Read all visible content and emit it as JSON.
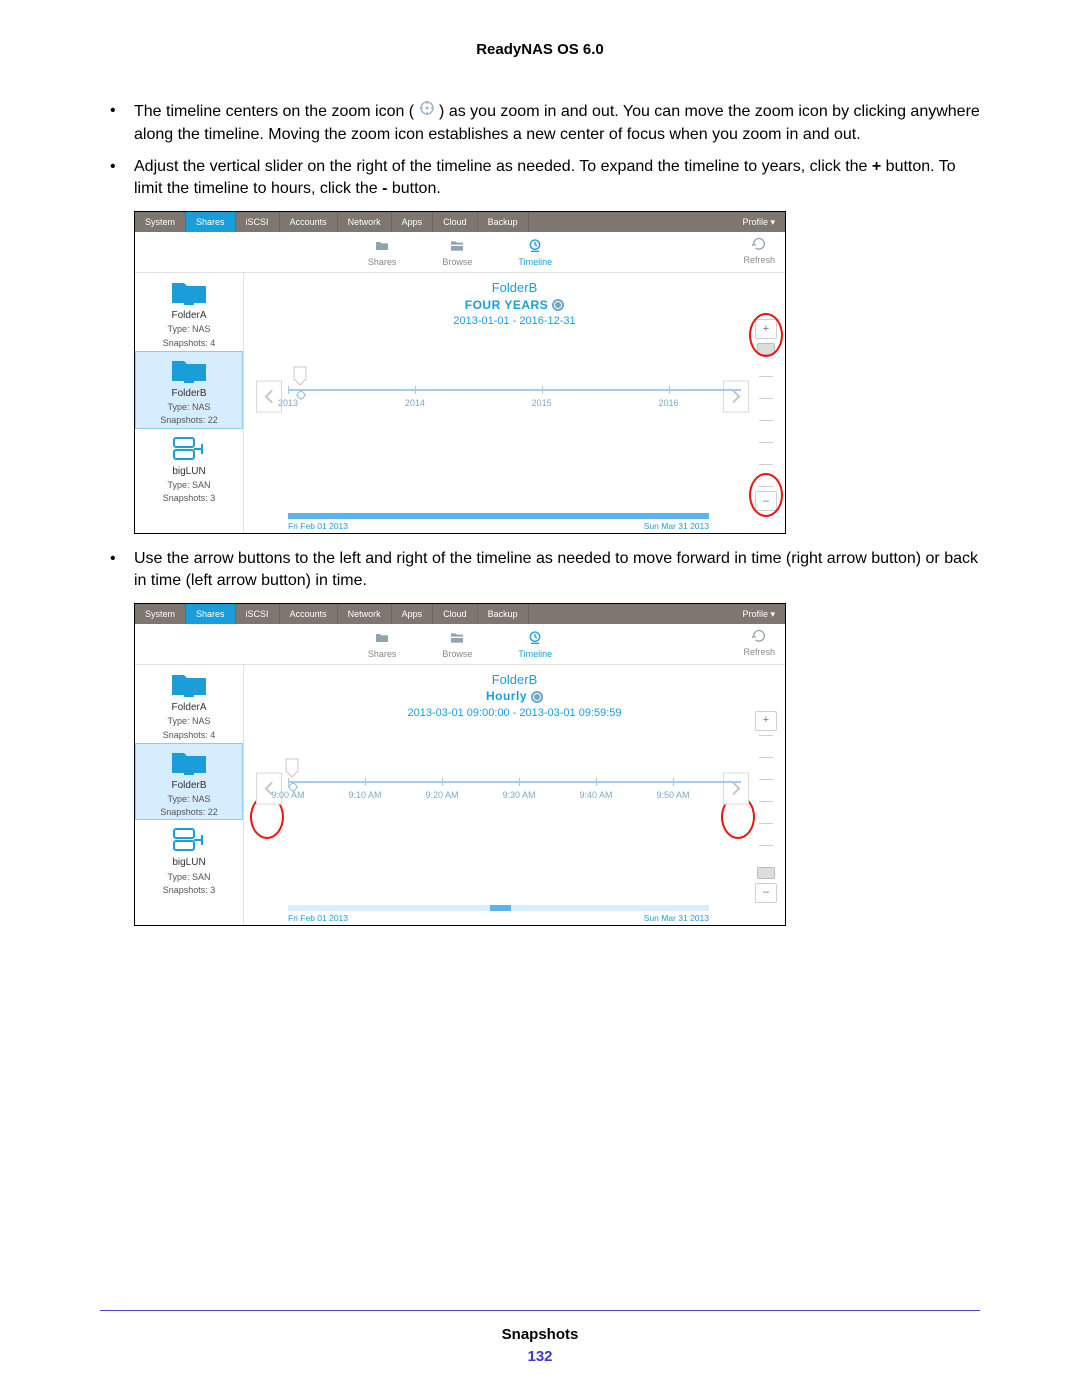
{
  "doc": {
    "title": "ReadyNAS OS 6.0",
    "footer_section": "Snapshots",
    "page_number": "132"
  },
  "bullets": {
    "b1_a": "The timeline centers on the zoom icon (",
    "b1_b": ") as you zoom in and out. You can move the zoom icon by clicking anywhere along the timeline. Moving the zoom icon establishes a new center of focus when you zoom in and out.",
    "b2_a": "Adjust the vertical slider on the right of the timeline as needed. To expand the timeline to years, click the ",
    "b2_plus": "+",
    "b2_b": " button. To limit the timeline to hours, click the ",
    "b2_minus": "-",
    "b2_c": " button.",
    "b3": "Use the arrow buttons to the left and right of the timeline as needed to move forward in time (right arrow button) or back in time (left arrow button) in time."
  },
  "nav": {
    "tabs": [
      "System",
      "Shares",
      "iSCSI",
      "Accounts",
      "Network",
      "Apps",
      "Cloud",
      "Backup"
    ],
    "profile": "Profile ▾"
  },
  "subnav": {
    "shares": "Shares",
    "browse": "Browse",
    "timeline": "Timeline",
    "refresh": "Refresh"
  },
  "sidebar": [
    {
      "name": "FolderA",
      "type": "Type:  NAS",
      "snap": "Snapshots:  4",
      "icon": "folder"
    },
    {
      "name": "FolderB",
      "type": "Type:  NAS",
      "snap": "Snapshots:  22",
      "icon": "folder",
      "selected": true
    },
    {
      "name": "bigLUN",
      "type": "Type:  SAN",
      "snap": "Snapshots:  3",
      "icon": "lun"
    }
  ],
  "shot1": {
    "title": "FolderB",
    "mode": "FOUR YEARS",
    "range": "2013-01-01  -  2016-12-31",
    "ticks": [
      "2013",
      "2014",
      "2015",
      "2016"
    ],
    "range_start": "Fri Feb 01 2013",
    "range_end": "Sun Mar 31 2013"
  },
  "shot2": {
    "title": "FolderB",
    "mode": "Hourly",
    "range": "2013-03-01 09:00:00  -  2013-03-01 09:59:59",
    "ticks": [
      "9:00 AM",
      "9:10 AM",
      "9:20 AM",
      "9:30 AM",
      "9:40 AM",
      "9:50 AM"
    ],
    "range_start": "Fri Feb 01 2013",
    "range_end": "Sun Mar 31 2013"
  },
  "slider": {
    "plus": "+",
    "minus": "–"
  }
}
